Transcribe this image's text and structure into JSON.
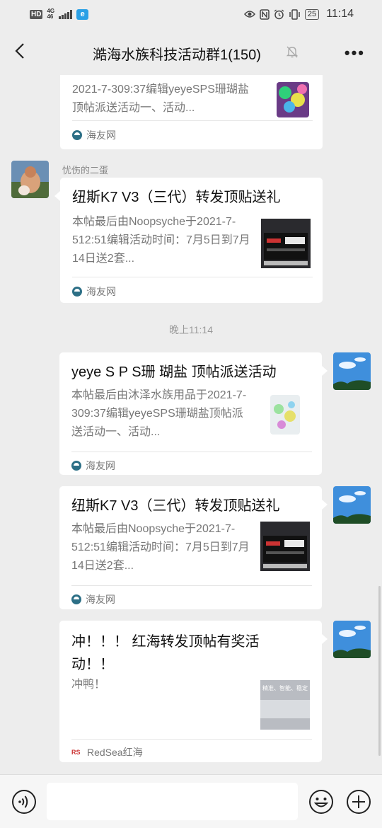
{
  "status_bar": {
    "hd": "HD",
    "net_top": "4G",
    "net_bottom": "46",
    "app_badge": "e",
    "battery": "25",
    "time": "11:14"
  },
  "header": {
    "title": "澔海水族科技活动群1(150)",
    "more": "•••"
  },
  "messages": [
    {
      "desc": "2021-7-309:37编辑yeyeSPS珊瑚盐顶帖派送活动一、活动...",
      "source": "海友网"
    },
    {
      "sender": "忧伤的二蛋",
      "title": "纽斯K7 V3（三代）转发顶贴送礼",
      "desc": "本帖最后由Noopsyche于2021-7-512:51编辑活动时间：7月5日到7月14日送2套...",
      "source": "海友网"
    },
    {
      "time": "晚上11:14"
    },
    {
      "title": "yeye S P S珊 瑚盐 顶帖派送活动",
      "desc": "本帖最后由沐泽水族用品于2021-7-309:37编辑yeyeSPS珊瑚盐顶帖派送活动一、活动...",
      "source": "海友网"
    },
    {
      "title": "纽斯K7 V3（三代）转发顶贴送礼",
      "desc": "本帖最后由Noopsyche于2021-7-512:51编辑活动时间：7月5日到7月14日送2套...",
      "source": "海友网"
    },
    {
      "title": "冲！！！ 红海转发顶帖有奖活动！！",
      "desc": "冲鸭！",
      "source": "RedSea红海",
      "thumb_caption": "精准、智能、稳定"
    }
  ],
  "colors": {
    "background": "#ededed",
    "card": "#ffffff",
    "muted_text": "#777777",
    "source_icon": "#2c6f86"
  }
}
